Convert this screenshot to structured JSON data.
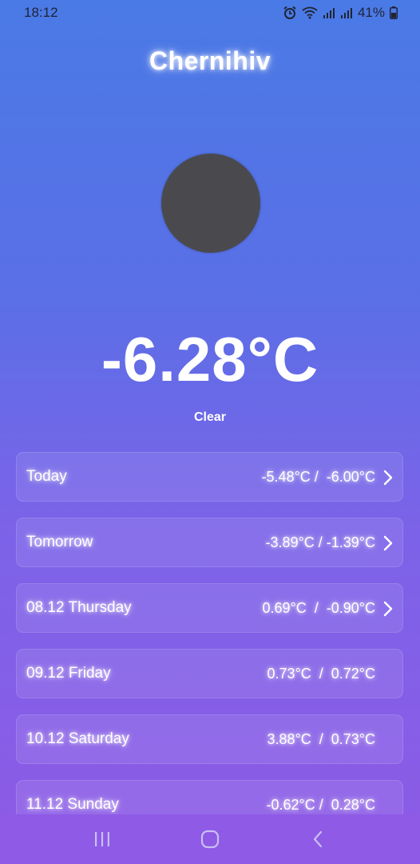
{
  "status": {
    "time": "18:12",
    "battery": "41%"
  },
  "city": "Chernihiv",
  "current": {
    "temp": "-6.28°C",
    "condition": "Clear"
  },
  "forecast": [
    {
      "label": "Today",
      "temps": "-5.48°C /  -6.00°C",
      "expandable": true
    },
    {
      "label": "Tomorrow",
      "temps": "-3.89°C / -1.39°C",
      "expandable": true
    },
    {
      "label": "08.12 Thursday",
      "temps": "0.69°C  /  -0.90°C",
      "expandable": true
    },
    {
      "label": "09.12 Friday",
      "temps": "0.73°C  /  0.72°C",
      "expandable": false
    },
    {
      "label": "10.12 Saturday",
      "temps": "3.88°C  /  0.73°C",
      "expandable": false
    },
    {
      "label": "11.12 Sunday",
      "temps": "-0.62°C /  0.28°C",
      "expandable": false
    }
  ],
  "icons": {
    "weather": "clear-sky-placeholder-icon",
    "row_chevron": "chevron-right-icon",
    "nav": [
      "recent-apps-icon",
      "home-icon",
      "back-icon"
    ]
  },
  "colors": {
    "gradient_top": "#4a7ae6",
    "gradient_bottom": "#8e5ae6",
    "status_text": "#1f2433",
    "icon_placeholder": "#4a4a4e"
  }
}
